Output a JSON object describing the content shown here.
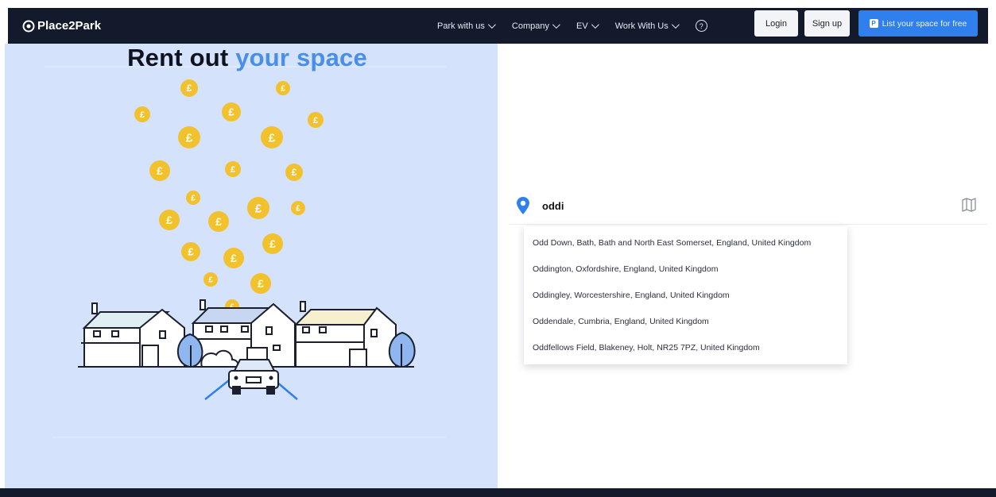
{
  "brand": {
    "name": "Place2Park"
  },
  "nav": {
    "items": [
      {
        "label": "Park with us"
      },
      {
        "label": "Company"
      },
      {
        "label": "EV"
      },
      {
        "label": "Work With Us"
      }
    ],
    "help_glyph": "?",
    "login_label": "Login",
    "signup_label": "Sign up",
    "list_space_label": "List your space for free",
    "list_space_badge": "P"
  },
  "hero": {
    "title_part1": "Rent out",
    "title_part2": "your space"
  },
  "search": {
    "value": "oddi",
    "icon": "location-pin-icon",
    "map_icon": "map-icon"
  },
  "suggestions": [
    {
      "label": "Odd Down, Bath, Bath and North East Somerset, England, United Kingdom"
    },
    {
      "label": "Oddington, Oxfordshire, England, United Kingdom"
    },
    {
      "label": "Oddingley, Worcestershire, England, United Kingdom"
    },
    {
      "label": "Oddendale, Cumbria, England, United Kingdom"
    },
    {
      "label": "Oddfellows Field, Blakeney, Holt, NR25 7PZ, United Kingdom"
    }
  ],
  "colors": {
    "navbar": "#131a2c",
    "accent_blue": "#2f80ed",
    "hero_bg": "#d4e3fb",
    "coin": "#f2c12e"
  },
  "coin_glyph": "£"
}
